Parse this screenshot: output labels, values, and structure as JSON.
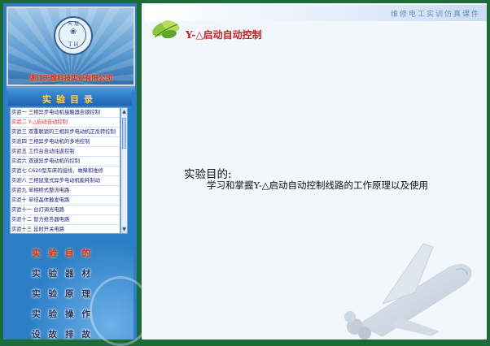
{
  "header": {
    "banner": "维修电工实训仿真课件",
    "page_title": "Y-△启动自动控制"
  },
  "logo": {
    "emblem_letters": "T H",
    "emblem_top": "天 煌",
    "company": "浙江天煌科技实业有限公司"
  },
  "menu": {
    "title": "实验目录",
    "items": [
      {
        "label": "实验一  三相异步电动机接触器自锁控制",
        "selected": false
      },
      {
        "label": "实验二  Y-△启动自动控制",
        "selected": true
      },
      {
        "label": "实验三  双重联锁的三相异步电动机正反转控制",
        "selected": false
      },
      {
        "label": "实验四  三相异步电动机的多地控制",
        "selected": false
      },
      {
        "label": "实验五  工作台自动往返控制",
        "selected": false
      },
      {
        "label": "实验六  双速异步电动机的控制",
        "selected": false
      },
      {
        "label": "实验七  C620型车床的接线、故障和维修",
        "selected": false
      },
      {
        "label": "实验八  三相鼠笼式异步电动机能耗制动",
        "selected": false
      },
      {
        "label": "实验九  单相桥式整流电路",
        "selected": false
      },
      {
        "label": "实验十  单结晶体触发电路",
        "selected": false
      },
      {
        "label": "实验十一  台灯调光电路",
        "selected": false
      },
      {
        "label": "实验十二  智力抢答器电路",
        "selected": false
      },
      {
        "label": "实验十三  延时开关电路",
        "selected": false
      }
    ]
  },
  "nav": {
    "objective": "实验目的",
    "equipment": "实验器材",
    "principle": "实验原理",
    "operation": "实验操作",
    "fault": "设故排故"
  },
  "content": {
    "purpose_label": "实验目的:",
    "purpose_text": "学习和掌握Y-△启动自动控制线路的工作原理以及使用"
  },
  "colors": {
    "frame": "#1e6b3a",
    "panel": "#2c7fc6",
    "accent_red": "#c41e24",
    "gold": "#ffd24a"
  }
}
